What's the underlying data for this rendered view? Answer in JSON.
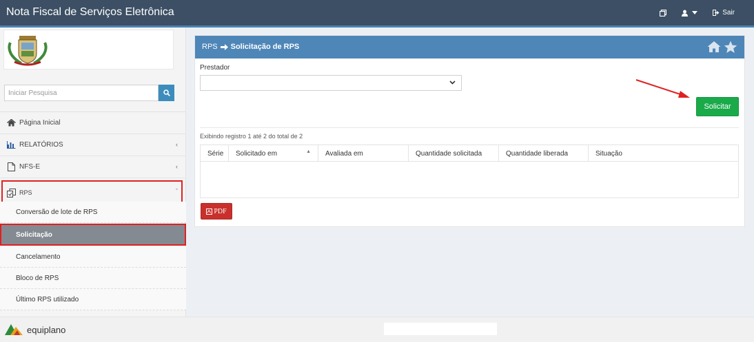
{
  "header": {
    "title": "Nota Fiscal de Serviços Eletrônica",
    "logout_label": "Sair"
  },
  "sidebar": {
    "search": {
      "placeholder": "Iniciar Pesquisa"
    },
    "items": [
      {
        "label": "Página Inicial",
        "icon": "home-icon"
      },
      {
        "label": "RELATÓRIOS",
        "icon": "bar-chart-icon"
      },
      {
        "label": "NFS-E",
        "icon": "file-icon"
      },
      {
        "label": "RPS",
        "icon": "copy-icon",
        "expanded": true
      }
    ],
    "rps_subitems": [
      {
        "label": "Conversão de lote de RPS"
      },
      {
        "label": "Solicitação",
        "active": true
      },
      {
        "label": "Cancelamento"
      },
      {
        "label": "Bloco de RPS"
      },
      {
        "label": "Último RPS utilizado"
      }
    ]
  },
  "main": {
    "breadcrumb": {
      "parent": "RPS",
      "current": "Solicitação de RPS"
    },
    "prestador_label": "Prestador",
    "solicitar_label": "Solicitar",
    "info_text": "Exibindo registro 1 até 2 do total de 2",
    "table": {
      "columns": [
        "Série",
        "Solicitado em",
        "Avaliada em",
        "Quantidade solicitada",
        "Quantidade liberada",
        "Situação"
      ]
    },
    "pdf_label": "PDF"
  },
  "footer": {
    "brand": "equiplano"
  },
  "colors": {
    "topbar": "#3c4f64",
    "card_header": "#4e86b8",
    "accent_green": "#1aaa4a",
    "pdf_red": "#c9302c",
    "highlight_red": "#e02020",
    "active_item": "#848a91"
  }
}
